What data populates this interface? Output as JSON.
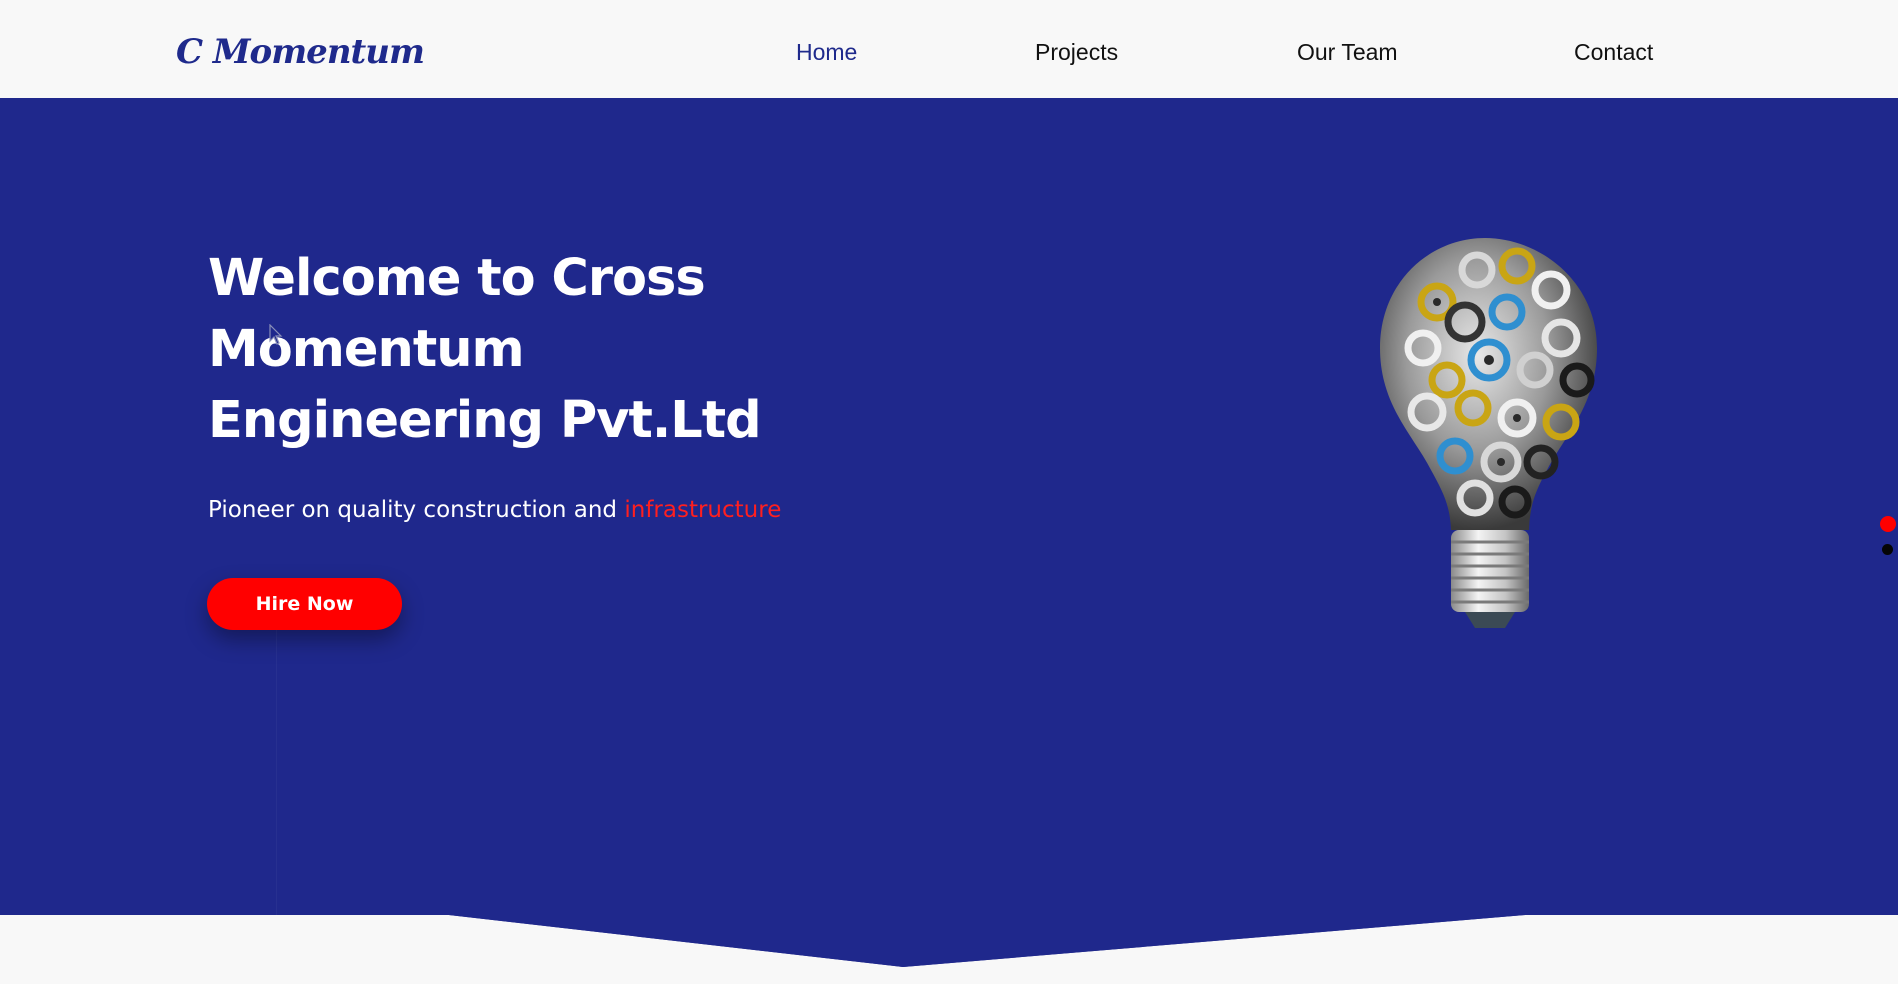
{
  "brand": {
    "logo_text": "C Momentum"
  },
  "nav": {
    "items": [
      {
        "label": "Home",
        "active": true
      },
      {
        "label": "Projects",
        "active": false
      },
      {
        "label": "Our Team",
        "active": false
      },
      {
        "label": "Contact",
        "active": false
      }
    ]
  },
  "hero": {
    "headline": "Welcome to Cross Momentum Engineering Pvt.Ltd",
    "tagline_prefix": "Pioneer on quality construction and",
    "tagline_accent": "infrastructure",
    "cta_label": "Hire Now",
    "slider": {
      "count": 2,
      "active_index": 0
    }
  },
  "colors": {
    "brand_blue": "#1f288c",
    "accent_red": "#ff0000",
    "page_bg": "#f8f8f8",
    "nav_text": "#111111"
  },
  "icons": {
    "hero_image": "gear-lightbulb-icon",
    "pointer": "mouse-cursor-icon"
  }
}
